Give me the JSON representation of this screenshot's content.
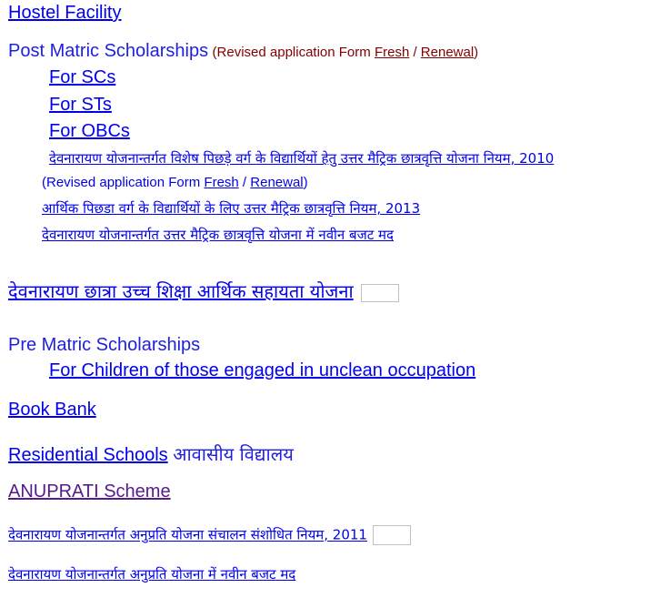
{
  "hostel": {
    "label": "Hostel Facility"
  },
  "post_matric": {
    "heading": "Post Matric Scholarships",
    "note_prefix": "(Revised application Form ",
    "fresh": "Fresh",
    "sep": " / ",
    "renewal": "Renewal",
    "note_suffix": ")",
    "items": [
      {
        "label": "For SCs"
      },
      {
        "label": "For STs"
      },
      {
        "label": "For OBCs"
      },
      {
        "label": "देवनारायण योजनान्तर्गत विशेष पिछड़े वर्ग के विद्यार्थियों हेतु उत्तर मैट्रिक छात्रवृत्ति योजना नियम, 2010"
      }
    ],
    "revised_note": {
      "prefix": "(Revised application Form ",
      "fresh": "Fresh",
      "sep": " / ",
      "renewal": "Renewal",
      "suffix": ")"
    },
    "ews_rules": "आर्थिक पिछडा वर्ग के विद्यार्थियों के लिए उत्तर मैट्रिक छात्रवृत्ति नियम, 2013 ",
    "devnarayan_budget": "देवनारायण योजनान्तर्गत उत्तर मैट्रिक छात्रवृत्ति योजना में नवीन बजट मद"
  },
  "devnarayan_girls": {
    "label": "देवनारायण छात्रा उच्च शिक्षा आर्थिक सहायता योजना",
    "image": "new-badge-image"
  },
  "pre_matric": {
    "heading": "Pre Matric Scholarships",
    "items": [
      {
        "label": "For Children of those engaged in unclean occupation"
      }
    ]
  },
  "book_bank": {
    "label": "Book Bank"
  },
  "residential": {
    "label": "Residential Schools",
    "hindi": "आवासीय विद्यालय"
  },
  "anuprati": {
    "label": "ANUPRATI Scheme"
  },
  "anuprati_rules": {
    "label": "देवनारायण योजनान्तर्गत अनुप्रति योजना संचालन संशोधित नियम, 2011",
    "image": "new-badge-image"
  },
  "anuprati_budget": {
    "label": "देवनारायण योजनान्तर्गत अनुप्रति योजना में नवीन बजट मद"
  }
}
